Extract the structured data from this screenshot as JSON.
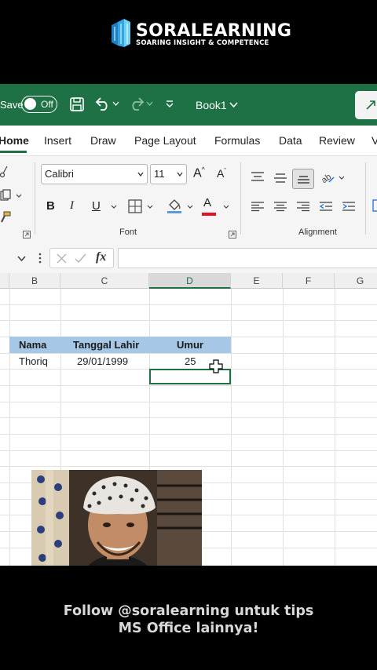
{
  "brand": {
    "name": "SORALEARNING",
    "tagline": "SOARING INSIGHT & COMPETENCE"
  },
  "titlebar": {
    "autosave_label": "Save",
    "toggle_state": "Off",
    "workbook_name": "Book1"
  },
  "tabs": [
    "Home",
    "Insert",
    "Draw",
    "Page Layout",
    "Formulas",
    "Data",
    "Review",
    "V"
  ],
  "ribbon": {
    "font_name": "Calibri",
    "font_size": "11",
    "font_group_label": "Font",
    "alignment_group_label": "Alignment"
  },
  "formula_bar": {
    "fx_label": "fx"
  },
  "columns": [
    "B",
    "C",
    "D",
    "E",
    "F",
    "G"
  ],
  "selected_column": "D",
  "table": {
    "headers": [
      "Nama",
      "Tanggal Lahir",
      "Umur"
    ],
    "rows": [
      [
        "Thoriq",
        "29/01/1999",
        "25"
      ]
    ]
  },
  "colors": {
    "excel_green": "#1e7145",
    "header_fill": "#a6c8e6",
    "font_color_bar": "#e81123"
  },
  "caption": {
    "line1": "Follow @soralearning untuk tips",
    "line2": "MS Office lainnya!"
  }
}
